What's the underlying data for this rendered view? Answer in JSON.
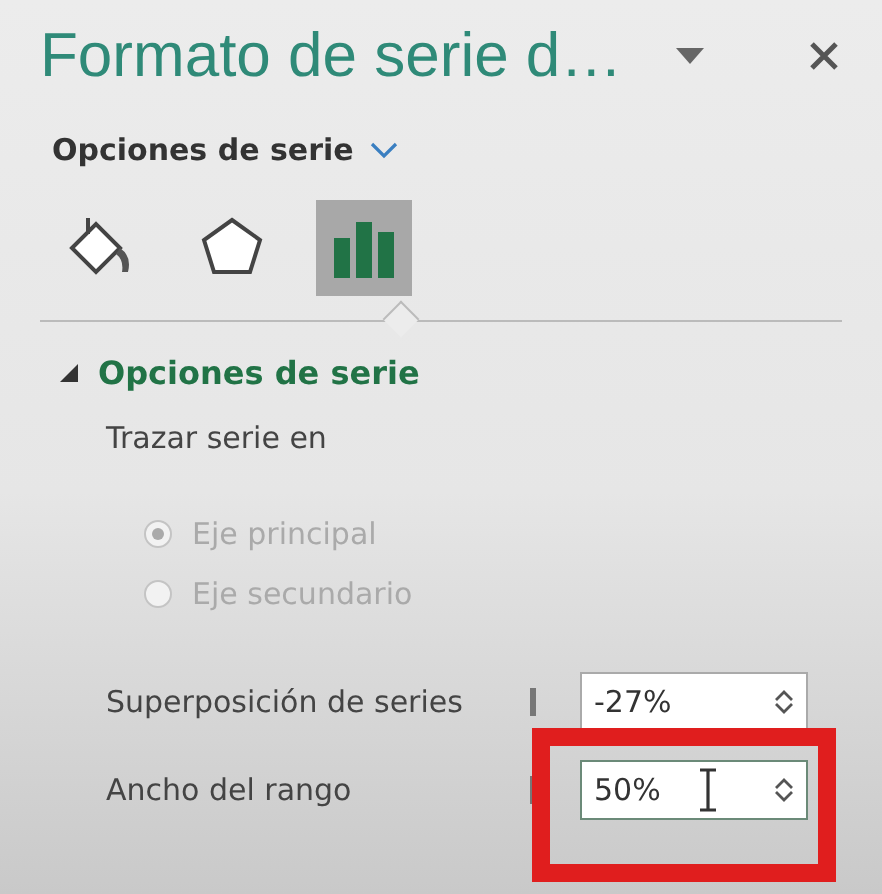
{
  "pane": {
    "title": "Formato de serie d…",
    "options_menu": "Opciones de serie"
  },
  "tabs": [
    {
      "kind": "fill",
      "selected": false
    },
    {
      "kind": "effects",
      "selected": false
    },
    {
      "kind": "series",
      "selected": true
    }
  ],
  "section": {
    "title": "Opciones de serie",
    "expanded": true,
    "plot_label": "Trazar serie en",
    "axes": [
      {
        "label": "Eje principal",
        "selected": true,
        "disabled": true
      },
      {
        "label": "Eje secundario",
        "selected": false,
        "disabled": true
      }
    ],
    "fields": [
      {
        "label": "Superposición de series",
        "value": "-27%",
        "highlighted": false
      },
      {
        "label": "Ancho del rango",
        "value": "50%",
        "highlighted": true
      }
    ]
  }
}
